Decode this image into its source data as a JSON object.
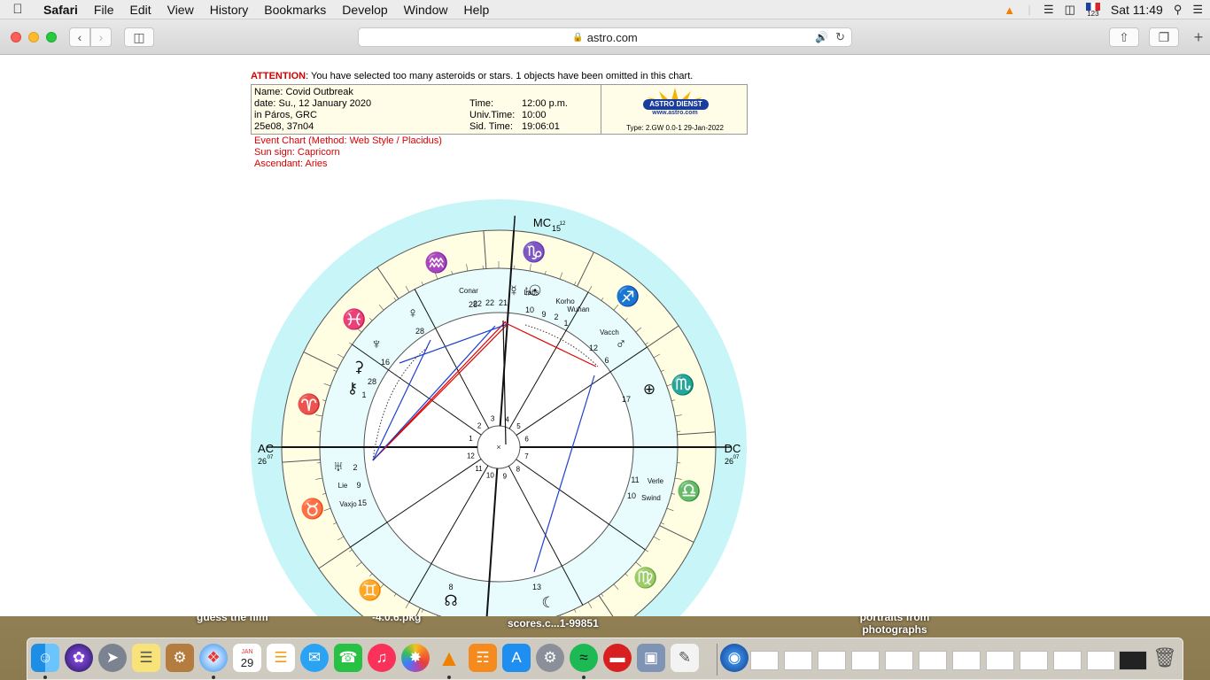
{
  "menubar": {
    "app": "Safari",
    "items": [
      "File",
      "Edit",
      "View",
      "History",
      "Bookmarks",
      "Develop",
      "Window",
      "Help"
    ],
    "clock": "Sat 11:49",
    "input_badge": "123"
  },
  "browser": {
    "url": "astro.com"
  },
  "page": {
    "attention_label": "ATTENTION",
    "attention_text": ": You have selected too many asteroids or stars. 1 objects have been omitted in this chart.",
    "name_line": "Name: Covid Outbreak",
    "date_line": "date: Su., 12 January 2020",
    "place_line": "in Páros, GRC",
    "coords_line": "25e08, 37n04",
    "time_label": "Time:",
    "time_value": "12:00 p.m.",
    "univ_label": "Univ.Time:",
    "univ_value": "10:00",
    "sid_label": "Sid. Time:",
    "sid_value": "19:06:01",
    "logo_badge": "ASTRO DIENST",
    "logo_url": "www.astro.com",
    "logo_type": "Type: 2.GW   0.0-1  29-Jan-2022",
    "chart_method": "Event Chart  (Method: Web Style / Placidus)",
    "sun_sign": "Sun sign: Capricorn",
    "ascendant": "Ascendant: Aries"
  },
  "wheel": {
    "colors": {
      "outer": "#c8f6f8",
      "zodiac": "#fffde2",
      "inner": "#e8fcfd",
      "red": "#e00000",
      "blue": "#1f3fd0",
      "green": "#1aa34a"
    },
    "angles": {
      "mc": "MC",
      "mc_deg": "15",
      "mc_min": "12",
      "ac": "AC",
      "ac_deg": "26",
      "ac_min": "07",
      "dc": "DC",
      "dc_deg": "26",
      "dc_min": "07"
    },
    "house_numbers": [
      "1",
      "2",
      "3",
      "4",
      "5",
      "6",
      "7",
      "8",
      "9",
      "10",
      "11",
      "12"
    ],
    "planet_labels": [
      {
        "text": "Conar"
      },
      {
        "text": "Labs"
      },
      {
        "text": "Korho"
      },
      {
        "text": "Wuhan"
      },
      {
        "text": "Vacch"
      },
      {
        "text": "Lie"
      },
      {
        "text": "Vaxjo"
      },
      {
        "text": "Verle"
      },
      {
        "text": "Swind"
      }
    ],
    "degrees": [
      {
        "text": "28"
      },
      {
        "text": "16"
      },
      {
        "text": "28"
      },
      {
        "text": "12"
      },
      {
        "text": "6"
      },
      {
        "text": "17"
      },
      {
        "text": "2"
      },
      {
        "text": "9"
      },
      {
        "text": "15"
      },
      {
        "text": "11"
      },
      {
        "text": "10"
      },
      {
        "text": "8"
      },
      {
        "text": "13"
      },
      {
        "text": "10"
      },
      {
        "text": "9"
      },
      {
        "text": "2"
      },
      {
        "text": "1"
      },
      {
        "text": "22"
      },
      {
        "text": "22"
      },
      {
        "text": "21"
      },
      {
        "text": "28"
      },
      {
        "text": "1"
      }
    ]
  },
  "desktop_labels": [
    "guess the film",
    "-4.0.6.pkg",
    "scores.c...1-99851",
    "portraits from photographs"
  ],
  "dock": {
    "calendar_month": "JAN",
    "calendar_day": "29"
  }
}
